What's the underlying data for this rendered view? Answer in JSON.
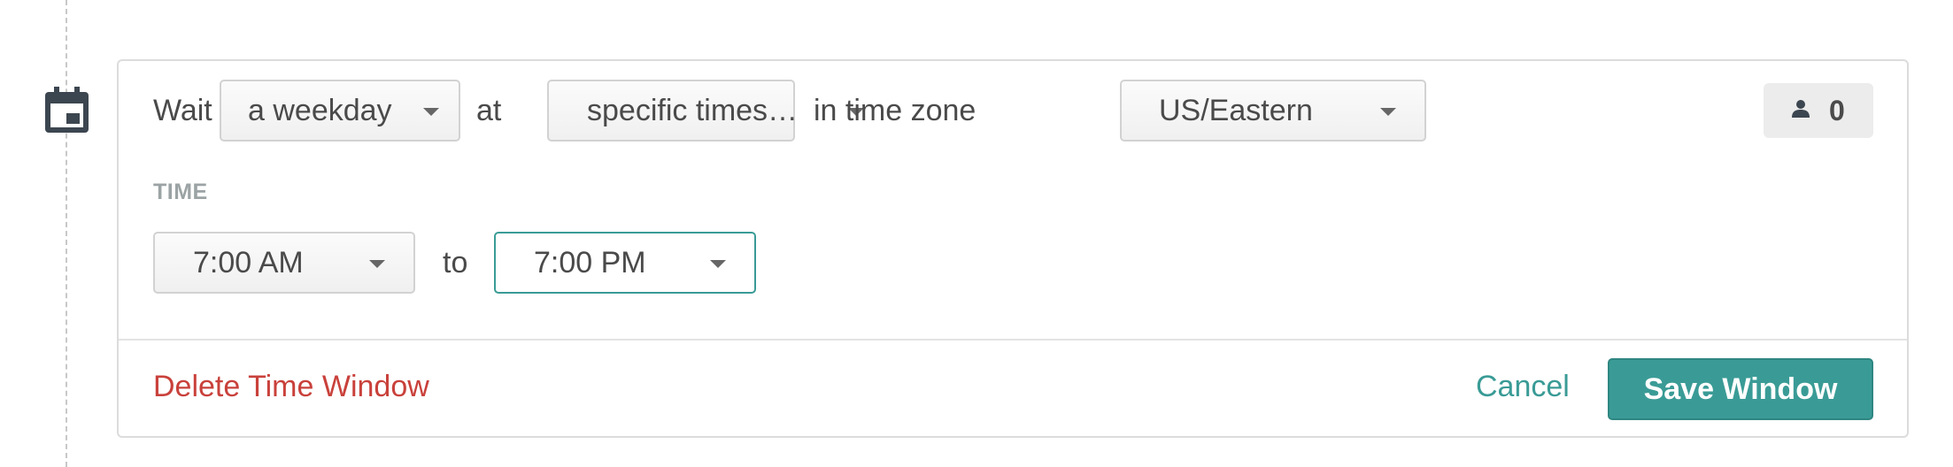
{
  "schedule": {
    "wait_label": "Wait until",
    "day_select": {
      "value": "a weekday"
    },
    "at_label": "at",
    "time_mode_select": {
      "value": "specific times…"
    },
    "timezone_label": "in time zone",
    "timezone_select": {
      "value": "US/Eastern"
    },
    "count_badge": {
      "icon": "person-icon",
      "value": "0"
    }
  },
  "time_section": {
    "label": "TIME",
    "start_select": {
      "value": "7:00 AM"
    },
    "to_label": "to",
    "end_select": {
      "value": "7:00 PM"
    }
  },
  "footer": {
    "delete_label": "Delete Time Window",
    "cancel_label": "Cancel",
    "save_label": "Save Window"
  },
  "colors": {
    "accent": "#3a9b96",
    "danger": "#c9413b",
    "muted_label": "#9ca3a4"
  },
  "timeline": {
    "icon": "calendar-icon"
  }
}
